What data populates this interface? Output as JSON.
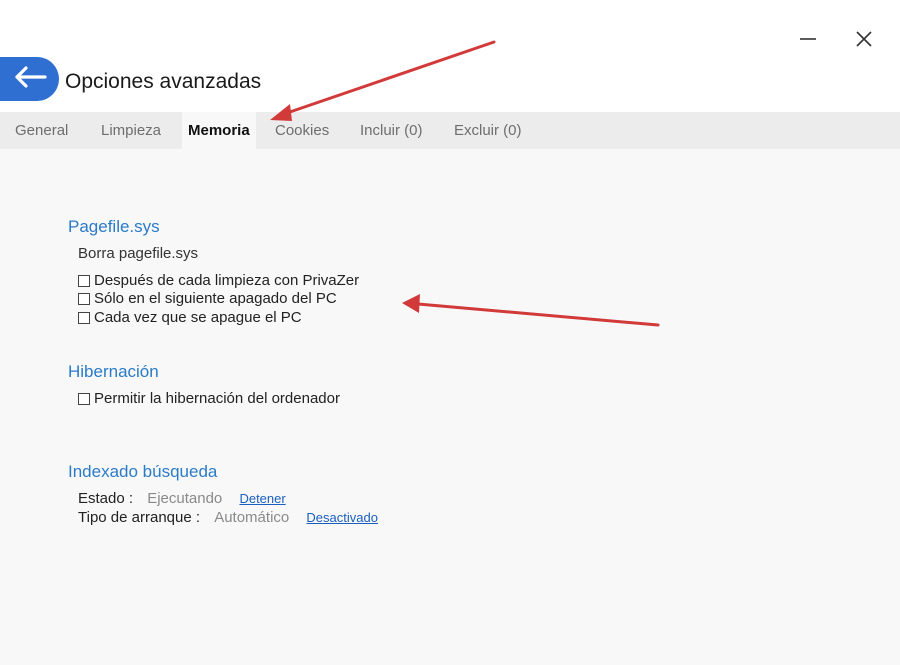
{
  "window": {
    "title": "Opciones avanzadas",
    "back_icon": "arrow-left-icon",
    "minimize_icon": "minimize-icon",
    "close_icon": "close-icon",
    "accent_color": "#2f6fd2"
  },
  "tabs": [
    {
      "label": "General",
      "active": false
    },
    {
      "label": "Limpieza",
      "active": false
    },
    {
      "label": "Memoria",
      "active": true
    },
    {
      "label": "Cookies",
      "active": false
    },
    {
      "label": "Incluir (0)",
      "active": false
    },
    {
      "label": "Excluir (0)",
      "active": false
    }
  ],
  "pagefile": {
    "title": "Pagefile.sys",
    "subtitle": "Borra pagefile.sys",
    "options": [
      {
        "label": "Después de cada limpieza con PrivaZer",
        "checked": false
      },
      {
        "label": "Sólo en el siguiente apagado del PC",
        "checked": false
      },
      {
        "label": "Cada vez que se apague el PC",
        "checked": false
      }
    ]
  },
  "hibernation": {
    "title": "Hibernación",
    "option": {
      "label": "Permitir la hibernación del ordenador",
      "checked": false
    }
  },
  "indexing": {
    "title": "Indexado búsqueda",
    "status_label": "Estado :",
    "status_value": "Ejecutando",
    "status_action": "Detener",
    "startup_label": "Tipo de arranque :",
    "startup_value": "Automático",
    "startup_action": "Desactivado"
  },
  "colors": {
    "section_title": "#2a7bc8",
    "link": "#1a5fc0",
    "annotation_arrow": "#d23a3a"
  }
}
